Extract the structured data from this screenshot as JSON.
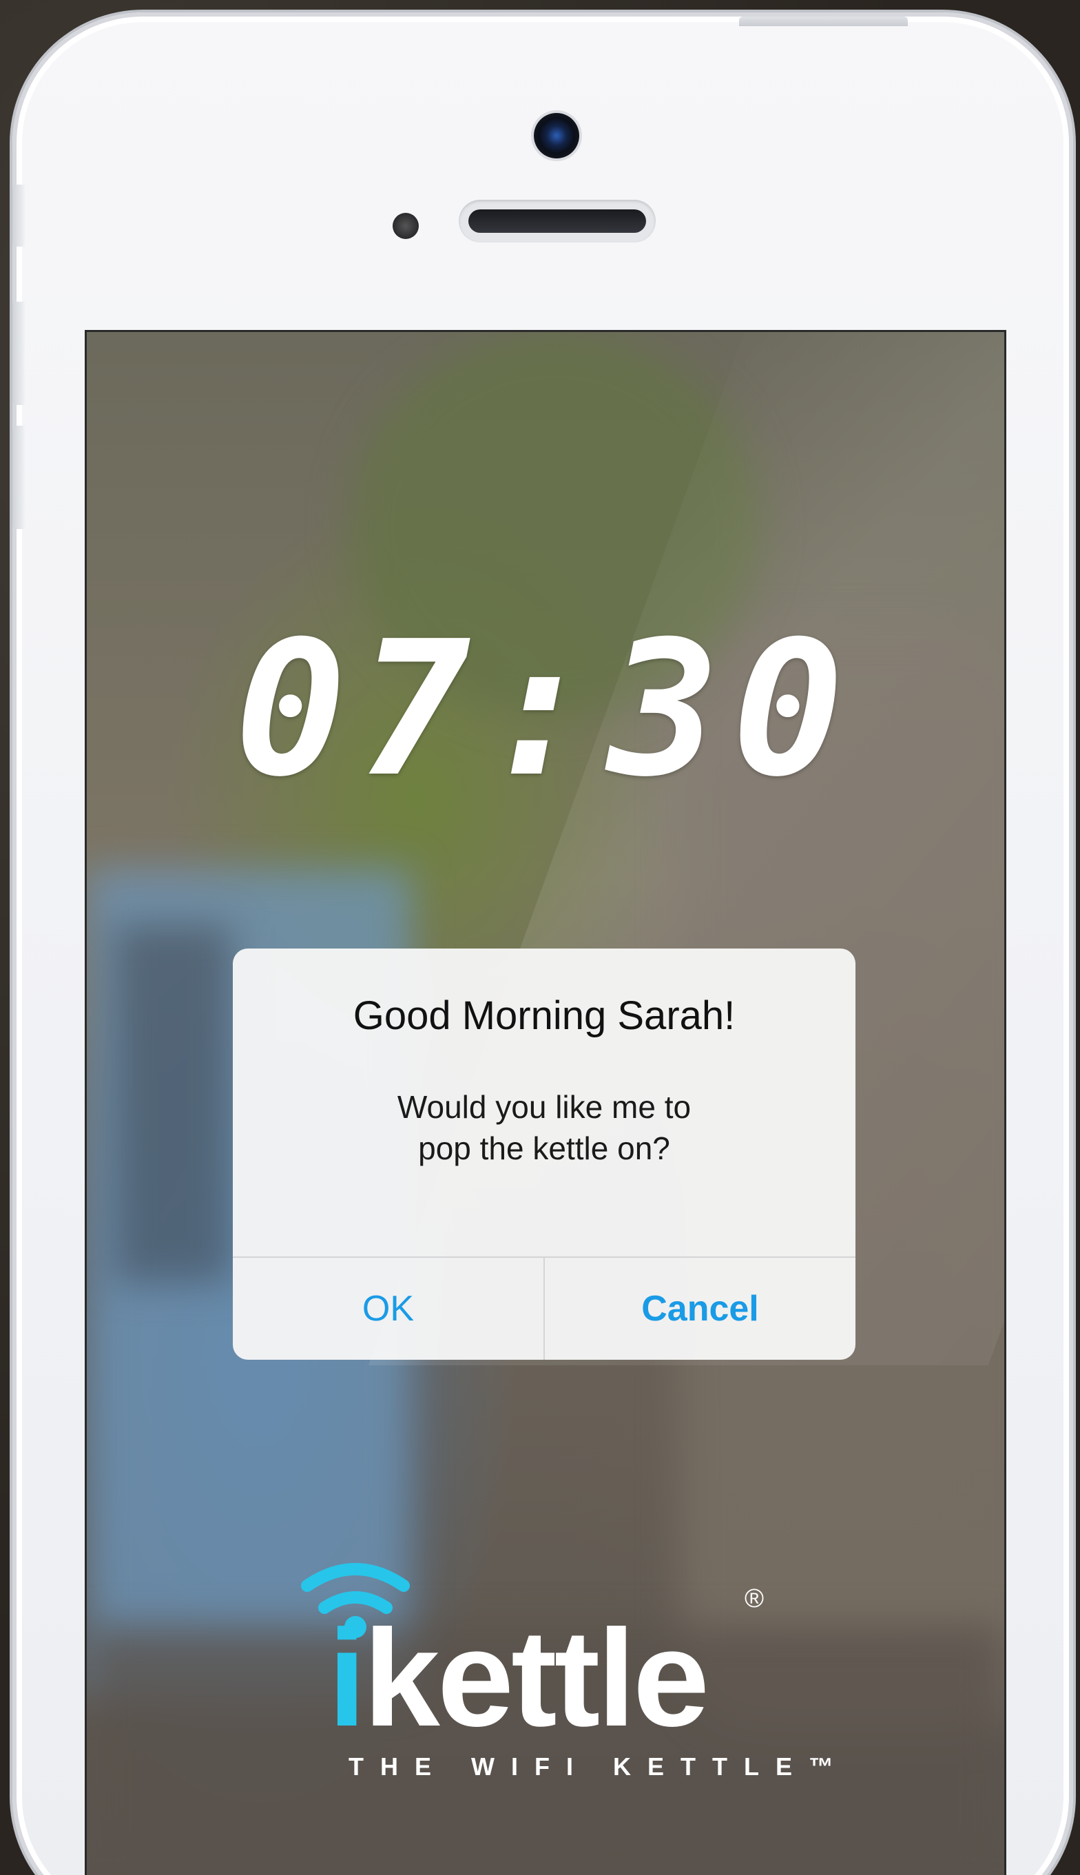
{
  "clock": {
    "time": "07:30"
  },
  "dialog": {
    "title": "Good Morning Sarah!",
    "message_line1": "Would you like me to",
    "message_line2": "pop the kettle on?",
    "ok_label": "OK",
    "cancel_label": "Cancel"
  },
  "logo": {
    "word_i": "i",
    "word_rest": "kettle",
    "registered": "®",
    "tagline": "THE WIFI KETTLE™"
  },
  "colors": {
    "accent": "#1a9be6",
    "brand_cyan": "#27c5ea",
    "phone_body": "#f2f3f6"
  },
  "icons": {
    "wifi": "wifi-icon",
    "camera": "front-camera-icon",
    "speaker": "earpiece-speaker-icon"
  }
}
